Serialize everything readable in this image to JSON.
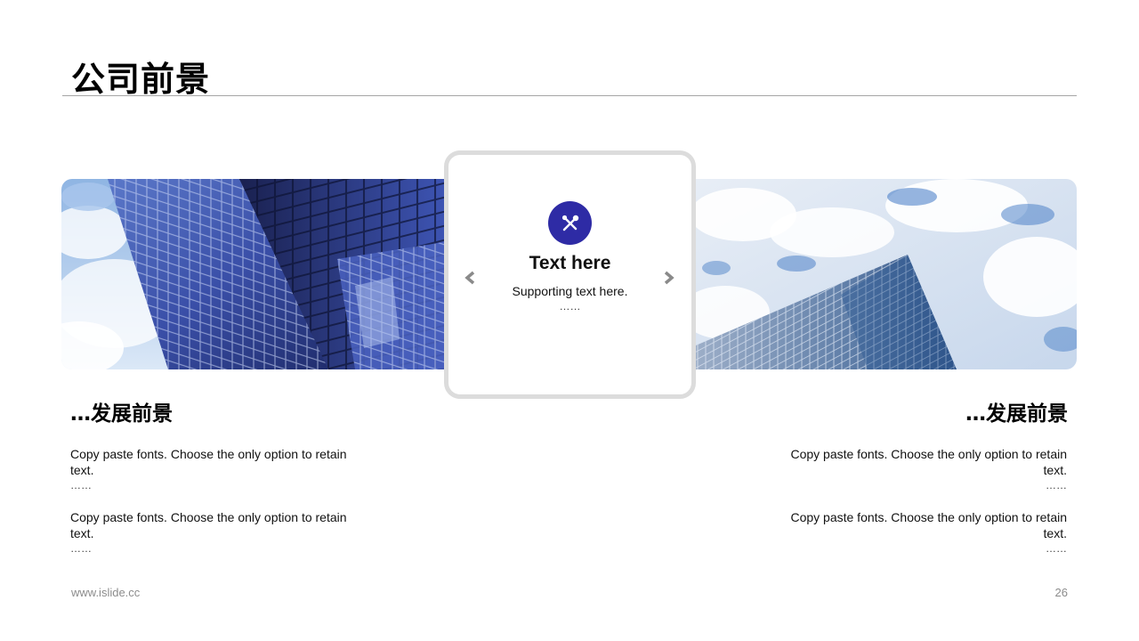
{
  "slide": {
    "title": "公司前景",
    "page_number": "26",
    "footer_url": "www.islide.cc"
  },
  "card": {
    "icon": "tools-icon",
    "title": "Text here",
    "subtitle": "Supporting  text here.",
    "dots": "……",
    "accent_color": "#2e2ba5"
  },
  "left_section": {
    "heading": "…发展前景",
    "paragraphs": [
      {
        "text": "Copy paste fonts. Choose the only option to retain text.",
        "dots": "……"
      },
      {
        "text": "Copy paste fonts. Choose the only option to retain text.",
        "dots": "……"
      }
    ]
  },
  "right_section": {
    "heading": "…发展前景",
    "paragraphs": [
      {
        "text": "Copy paste fonts. Choose the only option to retain text.",
        "dots": "……"
      },
      {
        "text": "Copy paste fonts. Choose the only option to retain text.",
        "dots": "……"
      }
    ]
  },
  "images": {
    "left": "office-building-photo",
    "right": "skyscraper-clouds-photo"
  }
}
